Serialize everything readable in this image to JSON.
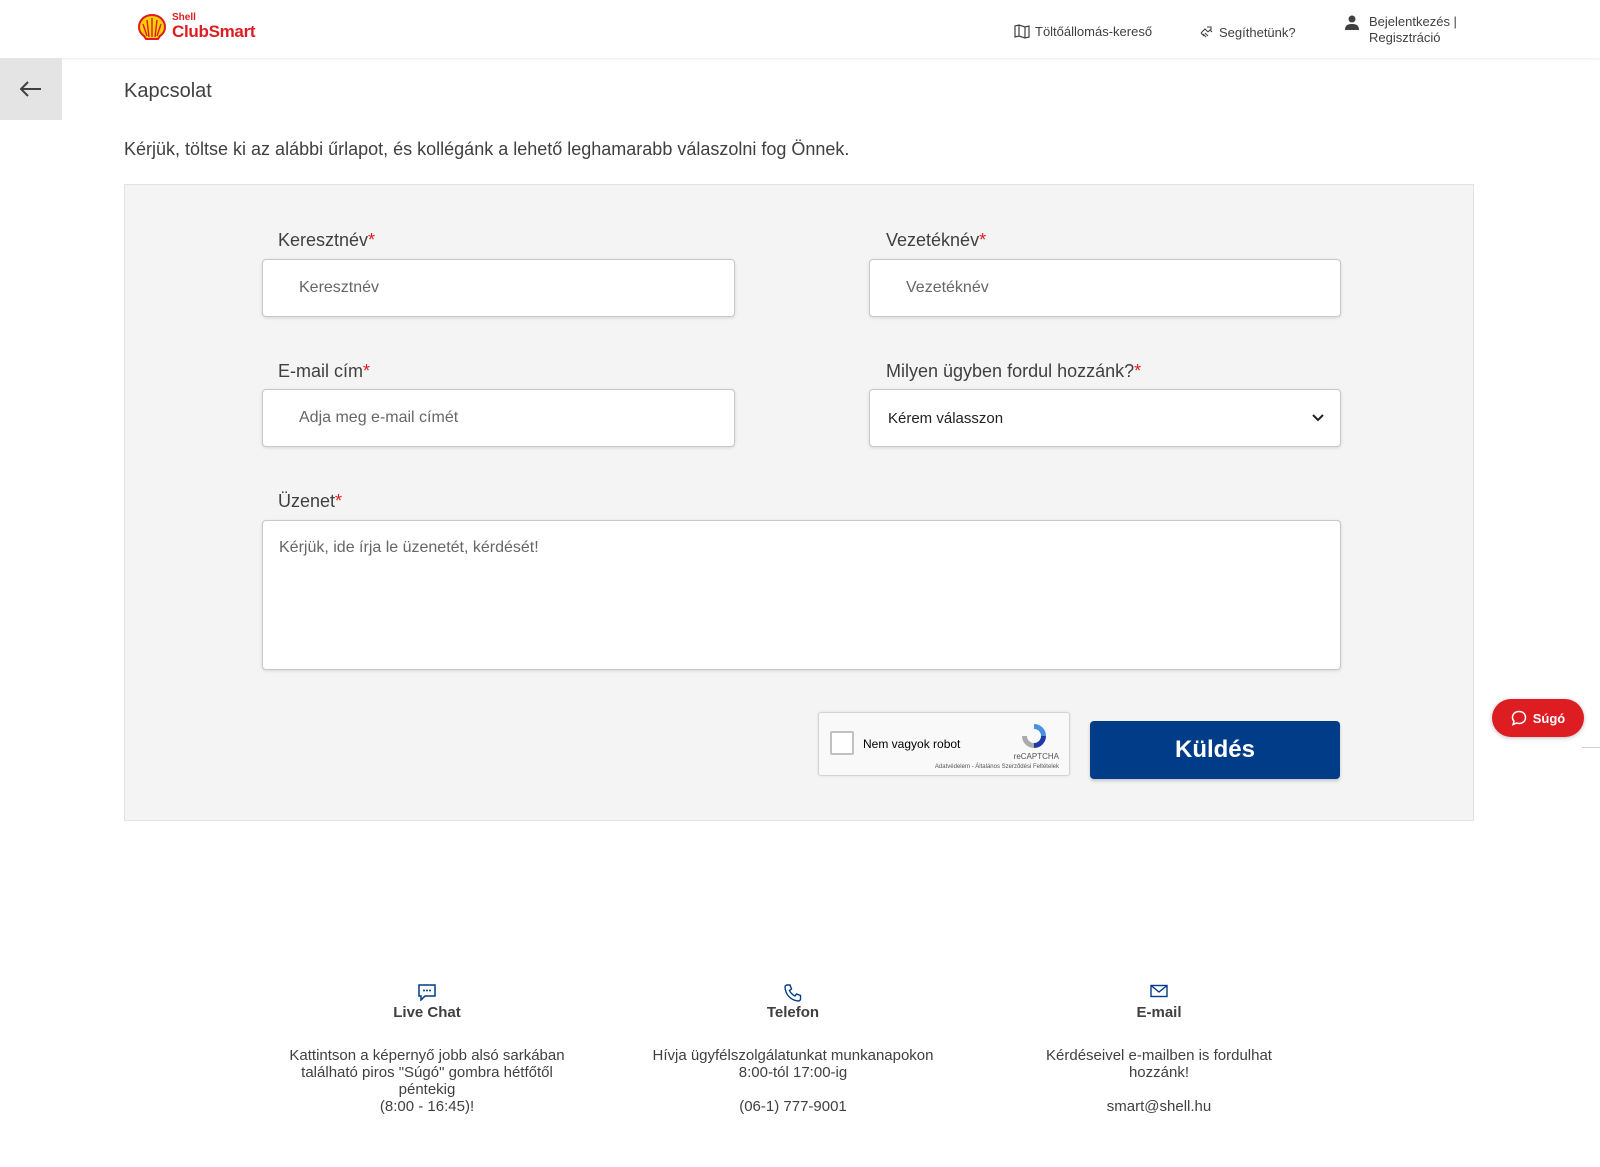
{
  "header": {
    "logo_small": "Shell",
    "logo_big": "ClubSmart",
    "nav_locator": "Töltőállomás-kereső",
    "nav_help": "Segíthetünk?",
    "nav_login": "Bejelentkezés |",
    "nav_register": "Regisztráció"
  },
  "page": {
    "title": "Kapcsolat",
    "intro": "Kérjük, töltse ki az alábbi űrlapot, és kollégánk a lehető leghamarabb válaszolni fog Önnek."
  },
  "form": {
    "firstname_label": "Keresztnév",
    "firstname_placeholder": "Keresztnév",
    "lastname_label": "Vezetéknév",
    "lastname_placeholder": "Vezetéknév",
    "email_label": "E-mail cím",
    "email_placeholder": "Adja meg e-mail címét",
    "topic_label": "Milyen ügyben fordul hozzánk?",
    "topic_selected": "Kérem válasszon",
    "message_label": "Üzenet",
    "message_placeholder": "Kérjük, ide írja le üzenetét, kérdését!",
    "required_mark": "*",
    "captcha_label": "Nem vagyok robot",
    "captcha_brand": "reCAPTCHA",
    "captcha_links": "Adatvédelem - Általános Szerződési Feltételek",
    "submit_label": "Küldés"
  },
  "help_button": "Súgó",
  "contacts": [
    {
      "title": "Live Chat",
      "icon": "chat-icon",
      "lines": [
        "Kattintson a képernyő jobb alsó sarkában",
        "található piros \"Súgó\" gombra hétfőtől",
        "péntekig",
        "(8:00 - 16:45)!"
      ]
    },
    {
      "title": "Telefon",
      "icon": "phone-icon",
      "lines": [
        "Hívja ügyfélszolgálatunkat munkanapokon",
        "8:00-tól 17:00-ig"
      ],
      "extra": "(06-1) 777-9001"
    },
    {
      "title": "E-mail",
      "icon": "mail-icon",
      "lines": [
        "Kérdéseivel e-mailben is fordulhat hozzánk!"
      ],
      "extra": "smart@shell.hu"
    }
  ],
  "colors": {
    "shell_red": "#dd1d21",
    "shell_yellow": "#fbce07",
    "primary_blue": "#003c88",
    "panel_bg": "#f4f4f4"
  }
}
